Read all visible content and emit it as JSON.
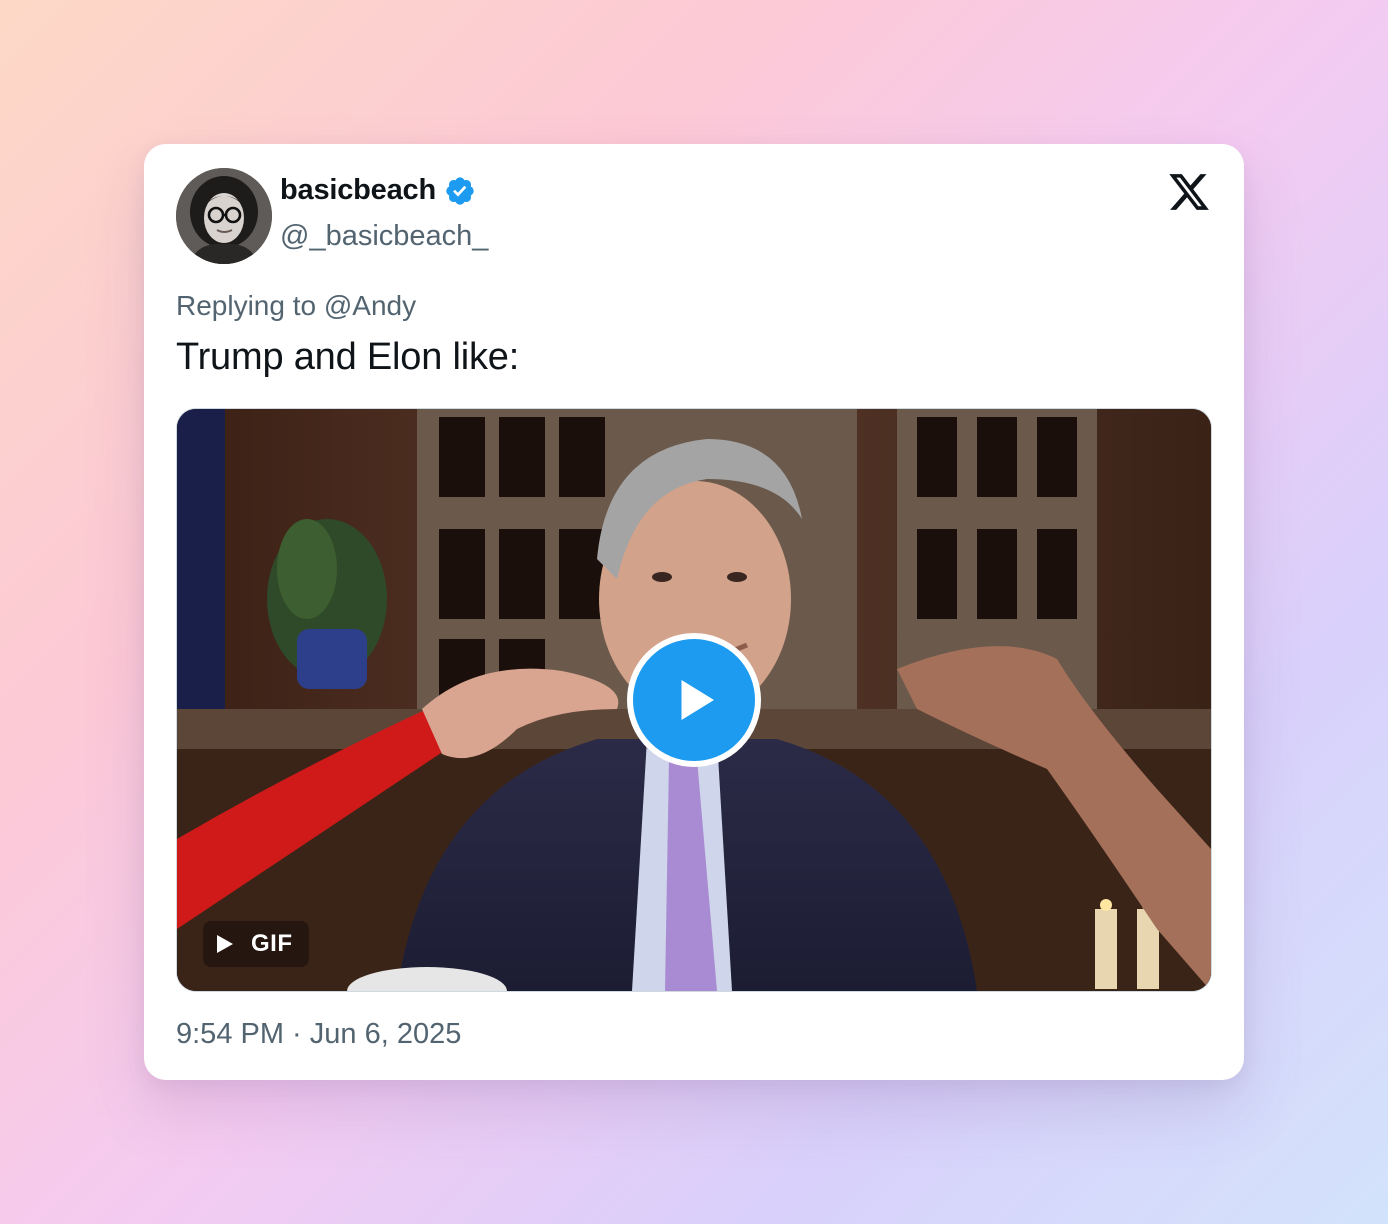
{
  "tweet": {
    "author": {
      "display_name": "basicbeach",
      "handle": "@_basicbeach_",
      "verified": true,
      "avatar_icon": "avatar-photo"
    },
    "platform_icon": "x-logo-icon",
    "replying_to": "Replying to @Andy",
    "text": "Trump and Elon like:",
    "media": {
      "type": "gif",
      "badge_label": "GIF",
      "play_icon": "play-icon"
    },
    "timestamp": "9:54 PM · Jun 6, 2025"
  },
  "colors": {
    "accent": "#1d9bf0",
    "text_primary": "#0f1419",
    "text_secondary": "#536471",
    "card_background": "#ffffff"
  }
}
